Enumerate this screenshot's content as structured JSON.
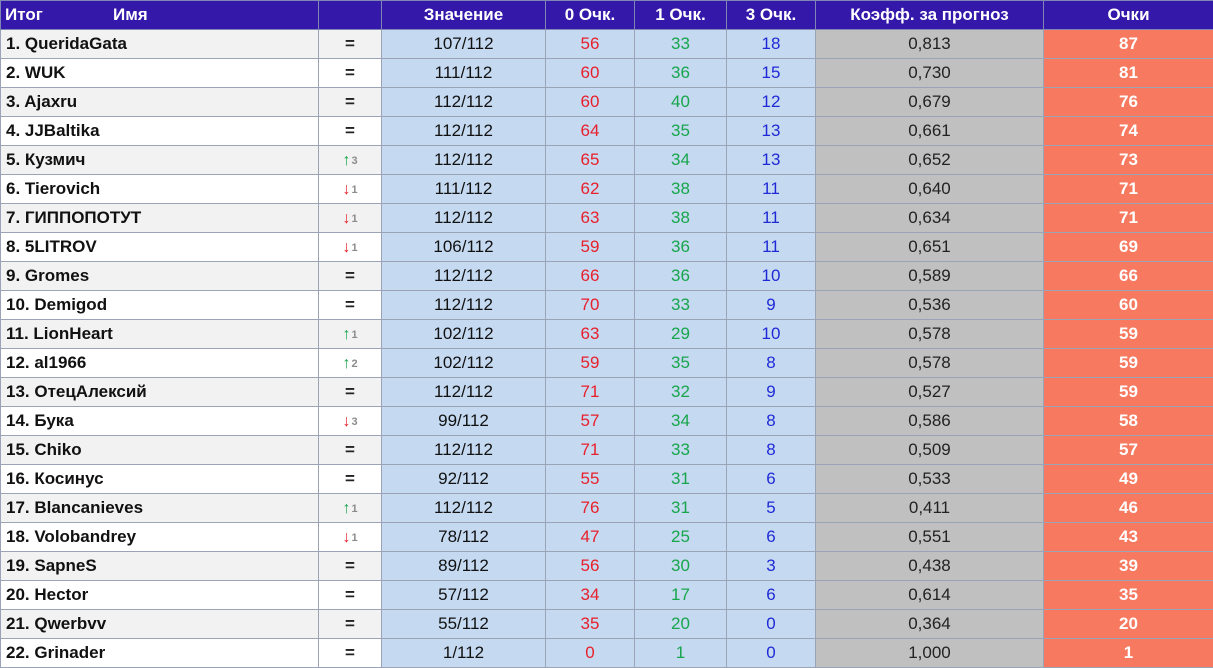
{
  "headers": {
    "itog": "Итог",
    "name": "Имя",
    "trend": "",
    "value": "Значение",
    "zero": "0 Очк.",
    "one": "1 Очк.",
    "three": "3 Очк.",
    "coef": "Коэфф. за прогноз",
    "points": "Очки"
  },
  "colors": {
    "header_bg": "#3318aa",
    "stats_bg": "#c5d9f1",
    "coef_bg": "#c0c0c0",
    "points_bg": "#f7795f",
    "zero_text": "#e8202b",
    "one_text": "#17a64b",
    "three_text": "#1f2ad6"
  },
  "rows": [
    {
      "name": "1. QueridaGata",
      "trend": "same",
      "delta": "",
      "value": "107/112",
      "zero": "56",
      "one": "33",
      "three": "18",
      "coef": "0,813",
      "points": "87"
    },
    {
      "name": "2. WUK",
      "trend": "same",
      "delta": "",
      "value": "111/112",
      "zero": "60",
      "one": "36",
      "three": "15",
      "coef": "0,730",
      "points": "81"
    },
    {
      "name": "3. Ajaxru",
      "trend": "same",
      "delta": "",
      "value": "112/112",
      "zero": "60",
      "one": "40",
      "three": "12",
      "coef": "0,679",
      "points": "76"
    },
    {
      "name": "4. JJBaltika",
      "trend": "same",
      "delta": "",
      "value": "112/112",
      "zero": "64",
      "one": "35",
      "three": "13",
      "coef": "0,661",
      "points": "74"
    },
    {
      "name": "5. Кузмич",
      "trend": "up",
      "delta": "3",
      "value": "112/112",
      "zero": "65",
      "one": "34",
      "three": "13",
      "coef": "0,652",
      "points": "73"
    },
    {
      "name": "6. Tierovich",
      "trend": "down",
      "delta": "1",
      "value": "111/112",
      "zero": "62",
      "one": "38",
      "three": "11",
      "coef": "0,640",
      "points": "71"
    },
    {
      "name": "7. ГИППОПОТУТ",
      "trend": "down",
      "delta": "1",
      "value": "112/112",
      "zero": "63",
      "one": "38",
      "three": "11",
      "coef": "0,634",
      "points": "71"
    },
    {
      "name": "8. 5LITROV",
      "trend": "down",
      "delta": "1",
      "value": "106/112",
      "zero": "59",
      "one": "36",
      "three": "11",
      "coef": "0,651",
      "points": "69"
    },
    {
      "name": "9. Gromes",
      "trend": "same",
      "delta": "",
      "value": "112/112",
      "zero": "66",
      "one": "36",
      "three": "10",
      "coef": "0,589",
      "points": "66"
    },
    {
      "name": "10. Demigod",
      "trend": "same",
      "delta": "",
      "value": "112/112",
      "zero": "70",
      "one": "33",
      "three": "9",
      "coef": "0,536",
      "points": "60"
    },
    {
      "name": "11. LionHeart",
      "trend": "up",
      "delta": "1",
      "value": "102/112",
      "zero": "63",
      "one": "29",
      "three": "10",
      "coef": "0,578",
      "points": "59"
    },
    {
      "name": "12. al1966",
      "trend": "up",
      "delta": "2",
      "value": "102/112",
      "zero": "59",
      "one": "35",
      "three": "8",
      "coef": "0,578",
      "points": "59"
    },
    {
      "name": "13. ОтецАлексий",
      "trend": "same",
      "delta": "",
      "value": "112/112",
      "zero": "71",
      "one": "32",
      "three": "9",
      "coef": "0,527",
      "points": "59"
    },
    {
      "name": "14. Бука",
      "trend": "down",
      "delta": "3",
      "value": "99/112",
      "zero": "57",
      "one": "34",
      "three": "8",
      "coef": "0,586",
      "points": "58"
    },
    {
      "name": "15. Chiko",
      "trend": "same",
      "delta": "",
      "value": "112/112",
      "zero": "71",
      "one": "33",
      "three": "8",
      "coef": "0,509",
      "points": "57"
    },
    {
      "name": "16. Косинус",
      "trend": "same",
      "delta": "",
      "value": "92/112",
      "zero": "55",
      "one": "31",
      "three": "6",
      "coef": "0,533",
      "points": "49"
    },
    {
      "name": "17. Blancanieves",
      "trend": "up",
      "delta": "1",
      "value": "112/112",
      "zero": "76",
      "one": "31",
      "three": "5",
      "coef": "0,411",
      "points": "46"
    },
    {
      "name": "18. Volobandrey",
      "trend": "down",
      "delta": "1",
      "value": "78/112",
      "zero": "47",
      "one": "25",
      "three": "6",
      "coef": "0,551",
      "points": "43"
    },
    {
      "name": "19. SapneS",
      "trend": "same",
      "delta": "",
      "value": "89/112",
      "zero": "56",
      "one": "30",
      "three": "3",
      "coef": "0,438",
      "points": "39"
    },
    {
      "name": "20. Hector",
      "trend": "same",
      "delta": "",
      "value": "57/112",
      "zero": "34",
      "one": "17",
      "three": "6",
      "coef": "0,614",
      "points": "35"
    },
    {
      "name": "21. Qwerbvv",
      "trend": "same",
      "delta": "",
      "value": "55/112",
      "zero": "35",
      "one": "20",
      "three": "0",
      "coef": "0,364",
      "points": "20"
    },
    {
      "name": "22. Grinader",
      "trend": "same",
      "delta": "",
      "value": "1/112",
      "zero": "0",
      "one": "1",
      "three": "0",
      "coef": "1,000",
      "points": "1"
    }
  ]
}
